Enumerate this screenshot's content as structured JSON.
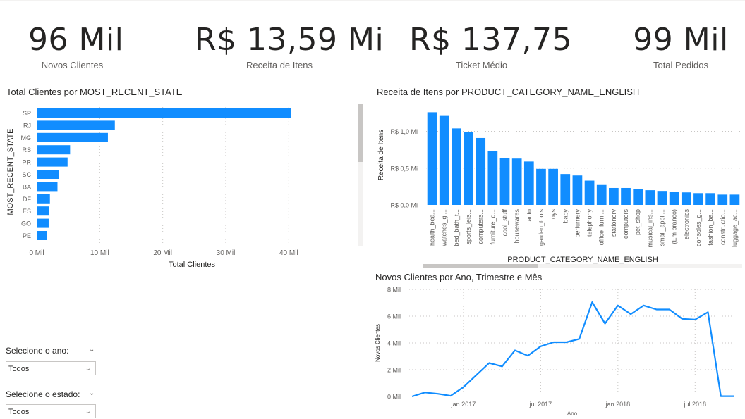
{
  "kpis": [
    {
      "value": "96 Mil",
      "label": "Novos Clientes"
    },
    {
      "value": "R$ 13,59 Mi",
      "label": "Receita de Itens"
    },
    {
      "value": "R$ 137,75",
      "label": "Ticket Médio"
    },
    {
      "value": "99 Mil",
      "label": "Total Pedidos"
    }
  ],
  "slicers": {
    "year": {
      "label": "Selecione o ano:",
      "value": "Todos"
    },
    "state": {
      "label": "Selecione o estado:",
      "value": "Todos"
    }
  },
  "colors": {
    "bar": "#118dff",
    "text": "#252423",
    "axis": "#605e5c",
    "grid": "#c8c6c4"
  },
  "chart_data": [
    {
      "type": "bar",
      "orientation": "horizontal",
      "title": "Total Clientes por MOST_RECENT_STATE",
      "xlabel": "Total Clientes",
      "ylabel": "MOST_RECENT_STATE",
      "categories": [
        "SP",
        "RJ",
        "MG",
        "RS",
        "PR",
        "SC",
        "BA",
        "DF",
        "ES",
        "GO",
        "PE"
      ],
      "values": [
        40.3,
        12.4,
        11.3,
        5.3,
        4.9,
        3.5,
        3.3,
        2.1,
        2.0,
        1.9,
        1.6
      ],
      "xticks": [
        "0 Mil",
        "10 Mil",
        "20 Mil",
        "30 Mil",
        "40 Mil"
      ],
      "xlim": [
        0,
        45
      ],
      "grid": true
    },
    {
      "type": "bar",
      "title": "Receita de Itens por PRODUCT_CATEGORY_NAME_ENGLISH",
      "xlabel": "PRODUCT_CATEGORY_NAME_ENGLISH",
      "ylabel": "Receita de Itens",
      "categories": [
        "health_bea...",
        "watches_gi...",
        "bed_bath_t...",
        "sports_leis...",
        "computers...",
        "furniture_d...",
        "cool_stuff",
        "housewares",
        "auto",
        "garden_tools",
        "toys",
        "baby",
        "perfumery",
        "telephony",
        "office_furni...",
        "stationery",
        "computers",
        "pet_shop",
        "musical_ins...",
        "small_appli...",
        "(Em branco)",
        "electronics",
        "consoles_g...",
        "fashion_ba...",
        "constructio...",
        "luggage_ac..."
      ],
      "values": [
        1.26,
        1.21,
        1.04,
        0.99,
        0.91,
        0.73,
        0.64,
        0.63,
        0.59,
        0.49,
        0.49,
        0.42,
        0.4,
        0.33,
        0.28,
        0.23,
        0.23,
        0.22,
        0.2,
        0.19,
        0.18,
        0.17,
        0.16,
        0.16,
        0.14,
        0.14
      ],
      "yticks": [
        "R$ 0,0 Mi",
        "R$ 0,5 Mi",
        "R$ 1,0 Mi"
      ],
      "ylim": [
        0,
        1.35
      ],
      "grid": true
    },
    {
      "type": "line",
      "title": "Novos Clientes por Ano, Trimestre e Mês",
      "xlabel": "Ano",
      "ylabel": "Novos Clientes",
      "x": [
        "2016-09",
        "2016-10",
        "2016-11",
        "2016-12",
        "2017-01",
        "2017-02",
        "2017-03",
        "2017-04",
        "2017-05",
        "2017-06",
        "2017-07",
        "2017-08",
        "2017-09",
        "2017-10",
        "2017-11",
        "2017-12",
        "2018-01",
        "2018-02",
        "2018-03",
        "2018-04",
        "2018-05",
        "2018-06",
        "2018-07",
        "2018-08",
        "2018-09",
        "2018-10"
      ],
      "values": [
        0.0,
        0.3,
        0.2,
        0.05,
        0.7,
        1.6,
        2.5,
        2.25,
        3.45,
        3.05,
        3.75,
        4.05,
        4.05,
        4.3,
        7.05,
        5.45,
        6.8,
        6.15,
        6.8,
        6.5,
        6.5,
        5.8,
        5.75,
        6.3,
        0.02,
        0.02
      ],
      "yticks": [
        "0 Mil",
        "2 Mil",
        "4 Mil",
        "6 Mil",
        "8 Mil"
      ],
      "xticks": [
        "jan 2017",
        "jul 2017",
        "jan 2018",
        "jul 2018"
      ],
      "ylim": [
        0,
        8
      ],
      "grid": true
    }
  ]
}
